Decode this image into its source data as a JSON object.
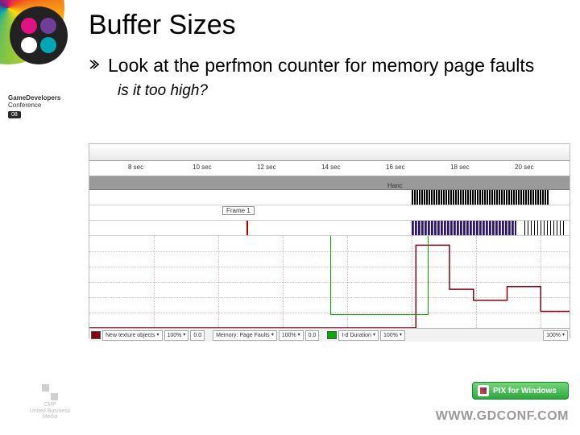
{
  "logo": {
    "petals": [
      "#e11383",
      "#6f3f98",
      "#fff",
      "#00a6b6"
    ]
  },
  "sidebar_conf": {
    "line1": "GameDevelopers",
    "line2": "Conference",
    "badge": "08"
  },
  "title": "Buffer Sizes",
  "bullet1": "Look at the perfmon counter for memory page faults",
  "sub1": "is it too high?",
  "chart_data": {
    "type": "line",
    "title": "",
    "xlabel": "time",
    "ylabel": "",
    "ruler_ticks": [
      "8 sec",
      "10 sec",
      "12 sec",
      "14 sec",
      "16 sec",
      "18 sec",
      "20 sec"
    ],
    "frame_marker": "Frame 1",
    "hanc_label": "Hanc",
    "series": [
      {
        "name": "Memory: Page Faults",
        "color": "#880015",
        "x": [
          0.0,
          0.68,
          0.68,
          0.75,
          0.75,
          0.8,
          0.8,
          0.87,
          0.87,
          0.94,
          0.94,
          1.0
        ],
        "y_norm": [
          1.0,
          1.0,
          0.1,
          0.1,
          0.58,
          0.58,
          0.7,
          0.7,
          0.55,
          0.55,
          0.82,
          0.82
        ]
      }
    ],
    "ylim_norm": [
      0,
      1
    ],
    "grid": true,
    "controls": [
      {
        "swatch": "#880015",
        "field1": "New texture objects",
        "pct": "100%",
        "val": "0.0",
        "field2": "Memory: Page Faults",
        "pct2": "100%",
        "val2": "0.0"
      },
      {
        "swatch": "#00aa00",
        "field1": "I-d Duration",
        "pct": "100%",
        "val": "",
        "field2": "",
        "pct2": "100%",
        "val2": ""
      }
    ]
  },
  "footer": {
    "pix_label": "PIX for Windows",
    "gdconf": "WWW.GDCONF.COM",
    "cmp_line1": "CMP",
    "cmp_line2": "United Business Media"
  }
}
